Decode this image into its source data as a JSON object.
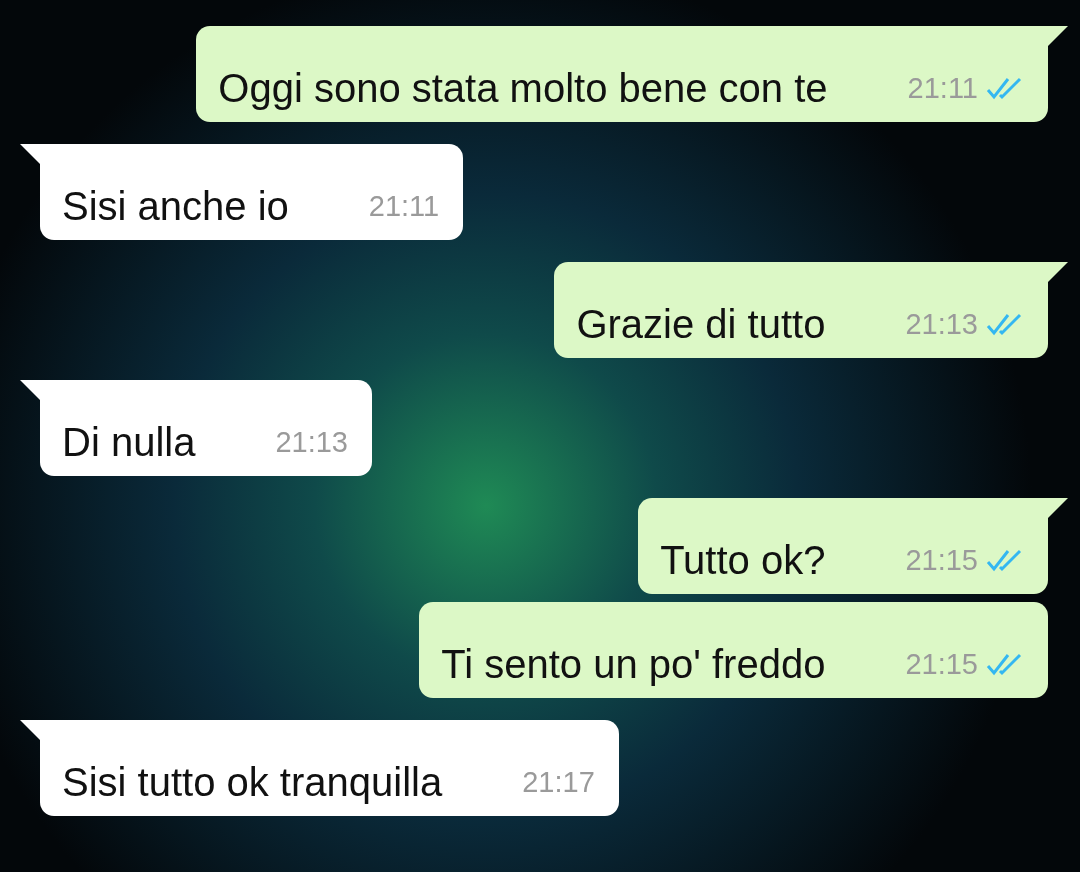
{
  "messages": [
    {
      "kind": "sent",
      "text": "Oggi sono stata molto bene con te",
      "time": "21:11",
      "read": true
    },
    {
      "kind": "received",
      "text": "Sisi anche io",
      "time": "21:11"
    },
    {
      "kind": "sent",
      "text": "Grazie di tutto",
      "time": "21:13",
      "read": true
    },
    {
      "kind": "received",
      "text": "Di nulla",
      "time": "21:13"
    },
    {
      "kind": "sent",
      "text": "Tutto ok?",
      "time": "21:15",
      "read": true
    },
    {
      "kind": "sent",
      "text": "Ti sento un po' freddo",
      "time": "21:15",
      "read": true
    },
    {
      "kind": "received",
      "text": "Sisi tutto ok tranquilla",
      "time": "21:17"
    }
  ]
}
